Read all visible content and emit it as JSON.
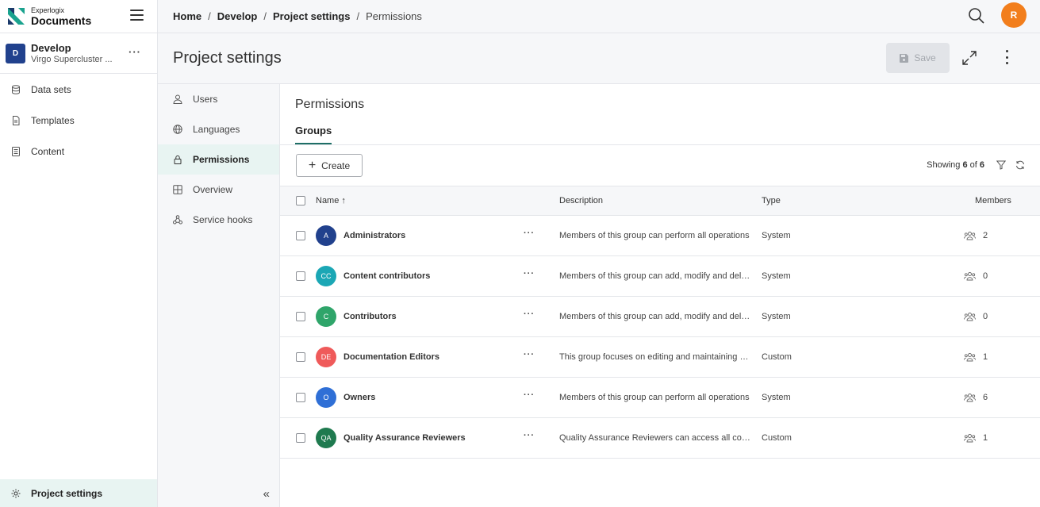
{
  "brand": {
    "line1": "Experlogix",
    "line2": "Documents",
    "colors": {
      "teal": "#1ba38f",
      "navy": "#1b3a6b"
    }
  },
  "project": {
    "badge": "D",
    "name": "Develop",
    "subtitle": "Virgo Supercluster ...",
    "more_label": "···"
  },
  "sidebar": {
    "items": [
      {
        "label": "Data sets",
        "icon": "database-icon"
      },
      {
        "label": "Templates",
        "icon": "document-icon"
      },
      {
        "label": "Content",
        "icon": "content-icon"
      }
    ],
    "bottom_item": {
      "label": "Project settings",
      "icon": "gear-icon"
    }
  },
  "breadcrumb": {
    "items": [
      "Home",
      "Develop",
      "Project settings"
    ],
    "current": "Permissions",
    "separator": "/"
  },
  "user": {
    "initial": "R",
    "color": "#f27e1c"
  },
  "header": {
    "title": "Project settings",
    "save_label": "Save"
  },
  "settings_nav": {
    "items": [
      {
        "label": "Users",
        "icon": "user-icon"
      },
      {
        "label": "Languages",
        "icon": "globe-icon"
      },
      {
        "label": "Permissions",
        "icon": "lock-icon",
        "active": true
      },
      {
        "label": "Overview",
        "icon": "grid-icon"
      },
      {
        "label": "Service hooks",
        "icon": "webhook-icon"
      }
    ],
    "collapse_label": "«"
  },
  "main": {
    "section_title": "Permissions",
    "tab": "Groups",
    "create_label": "Create",
    "showing": {
      "prefix": "Showing",
      "count": "6",
      "of": "of",
      "total": "6"
    },
    "columns": {
      "name": "Name ↑",
      "description": "Description",
      "type": "Type",
      "members": "Members"
    },
    "groups": [
      {
        "initials": "A",
        "color": "#21418d",
        "name": "Administrators",
        "description": "Members of this group can perform all operations",
        "type": "System",
        "members": "2"
      },
      {
        "initials": "CC",
        "color": "#1ba7b5",
        "name": "Content contributors",
        "description": "Members of this group can add, modify and delete content",
        "type": "System",
        "members": "0"
      },
      {
        "initials": "C",
        "color": "#2fa56a",
        "name": "Contributors",
        "description": "Members of this group can add, modify and delete items",
        "type": "System",
        "members": "0"
      },
      {
        "initials": "DE",
        "color": "#ef5a5a",
        "name": "Documentation Editors",
        "description": "This group focuses on editing and maintaining documentation",
        "type": "Custom",
        "members": "1"
      },
      {
        "initials": "O",
        "color": "#2f6fd6",
        "name": "Owners",
        "description": "Members of this group can perform all operations",
        "type": "System",
        "members": "6"
      },
      {
        "initials": "QA",
        "color": "#1f7a4f",
        "name": "Quality Assurance Reviewers",
        "description": "Quality Assurance Reviewers can access all content",
        "type": "Custom",
        "members": "1"
      }
    ],
    "row_more_label": "···"
  }
}
